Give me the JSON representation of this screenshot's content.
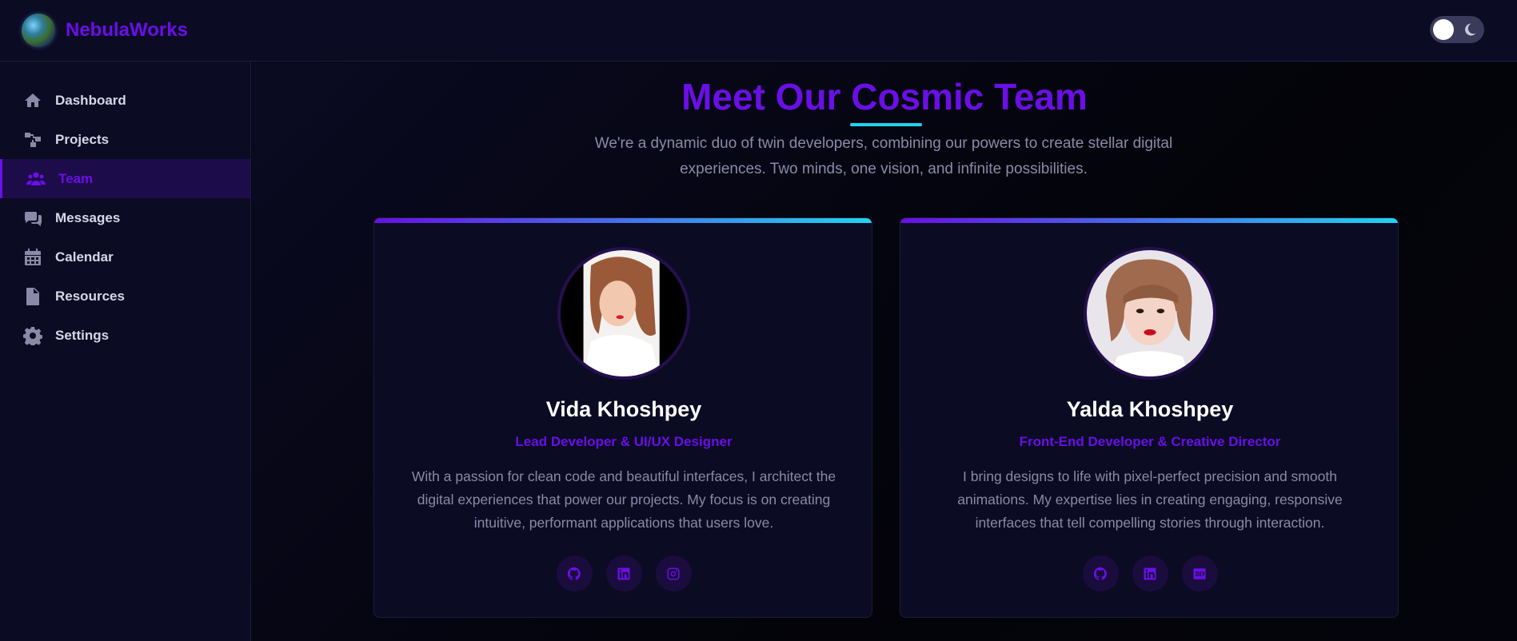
{
  "app": {
    "brand": "NebulaWorks"
  },
  "sidebar": {
    "items": [
      {
        "label": "Dashboard",
        "icon": "home-icon",
        "active": false
      },
      {
        "label": "Projects",
        "icon": "project-diagram-icon",
        "active": false
      },
      {
        "label": "Team",
        "icon": "users-icon",
        "active": true
      },
      {
        "label": "Messages",
        "icon": "comments-icon",
        "active": false
      },
      {
        "label": "Calendar",
        "icon": "calendar-icon",
        "active": false
      },
      {
        "label": "Resources",
        "icon": "file-icon",
        "active": false
      },
      {
        "label": "Settings",
        "icon": "gear-icon",
        "active": false
      }
    ]
  },
  "theme_toggle": {
    "state": "dark",
    "icon": "moon-icon"
  },
  "main": {
    "title": "Meet Our Cosmic Team",
    "intro": "We're a dynamic duo of twin developers, combining our powers to create stellar digital experiences. Two minds, one vision, and infinite possibilities.",
    "members": [
      {
        "name": "Vida Khoshpey",
        "role": "Lead Developer & UI/UX Designer",
        "bio": "With a passion for clean code and beautiful interfaces, I architect the digital experiences that power our projects. My focus is on creating intuitive, performant applications that users love.",
        "socials": [
          "github-icon",
          "linkedin-icon",
          "instagram-icon"
        ]
      },
      {
        "name": "Yalda Khoshpey",
        "role": "Front-End Developer & Creative Director",
        "bio": "I bring designs to life with pixel-perfect precision and smooth animations. My expertise lies in creating engaging, responsive interfaces that tell compelling stories through interaction.",
        "socials": [
          "github-icon",
          "linkedin-icon",
          "dev-icon"
        ]
      }
    ]
  },
  "colors": {
    "accent": "#6a0fe6",
    "accent_secondary": "#22d3ee",
    "background": "#06061a",
    "panel": "#0b0b24",
    "muted_text": "#8a8aa8"
  }
}
